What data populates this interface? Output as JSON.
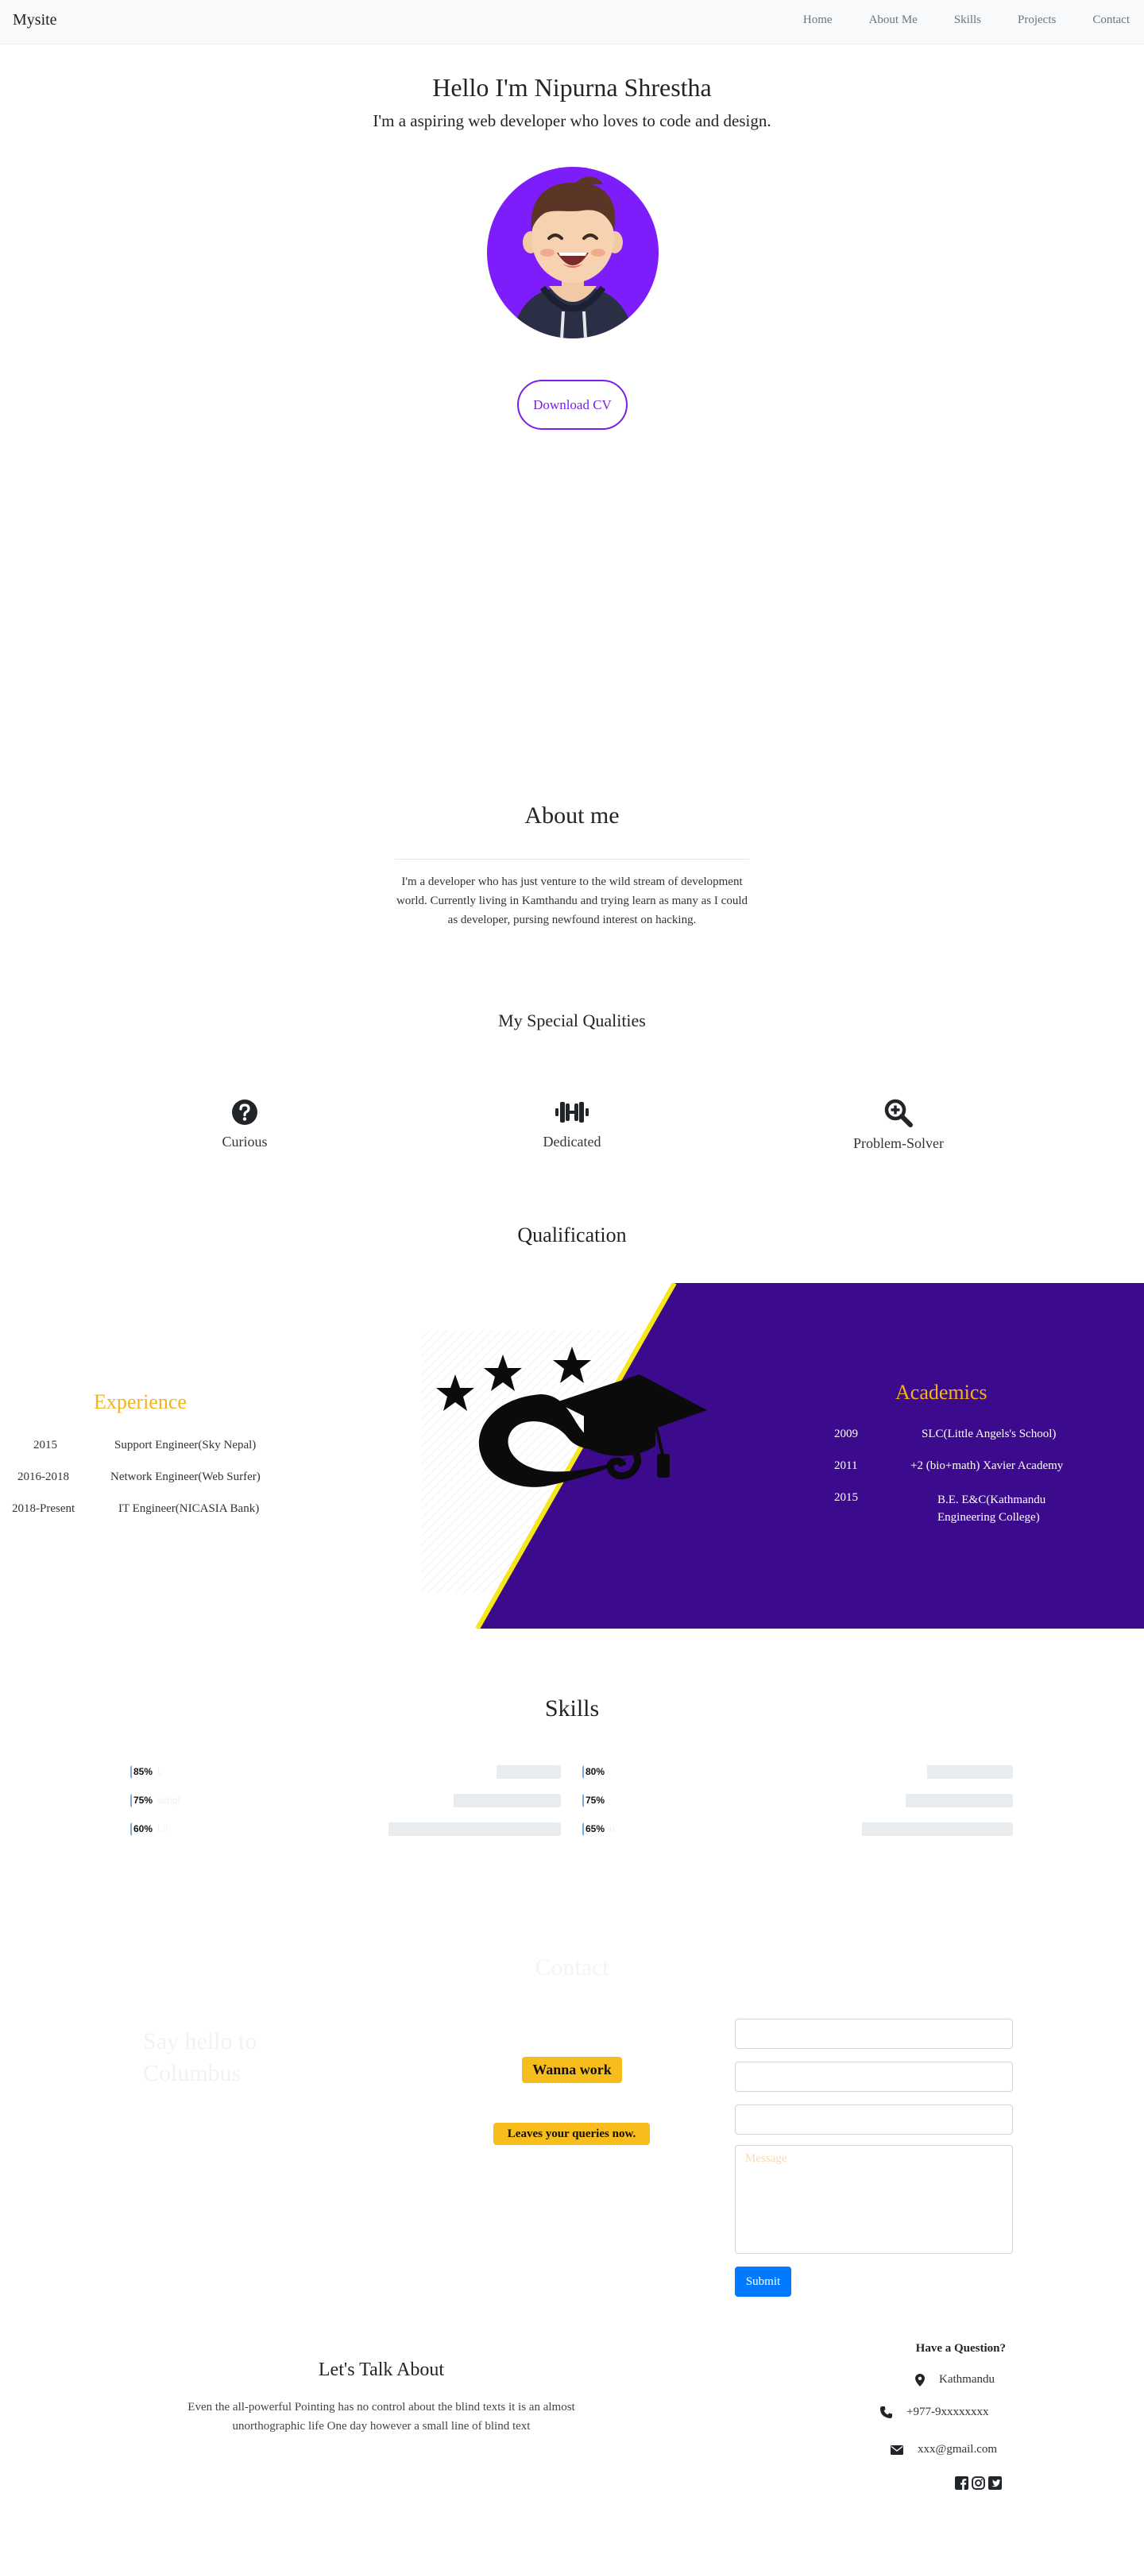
{
  "nav": {
    "brand": "Mysite",
    "links": [
      "Home",
      "About Me",
      "Skills",
      "Projects",
      "Contact"
    ]
  },
  "hero": {
    "title": "Hello I'm Nipurna Shrestha",
    "subtitle": "I'm a aspiring web developer who loves to code and design.",
    "cv_button": "Download CV"
  },
  "about": {
    "title": "About me",
    "text": "I'm a developer who has just venture to the wild stream of development world. Currently living in Kamthandu and trying learn as many as I could as developer, pursing newfound interest on hacking."
  },
  "qualities": {
    "title": "My Special Qualities",
    "items": [
      {
        "label": "Curious",
        "icon": "question-circle-icon"
      },
      {
        "label": "Dedicated",
        "icon": "dumbbell-icon"
      },
      {
        "label": "Problem-Solver",
        "icon": "search-plus-icon"
      }
    ]
  },
  "qualification": {
    "title": "Qualification",
    "experience_title": "Experience",
    "experience": [
      {
        "year": "2015",
        "role": "Support Engineer(Sky Nepal)"
      },
      {
        "year": "2016-2018",
        "role": "Network Engineer(Web Surfer)"
      },
      {
        "year": "2018-Present",
        "role": "IT Engineer(NICASIA Bank)"
      }
    ],
    "academics_title": "Academics",
    "academics": [
      {
        "year": "2009",
        "school": "SLC(Little Angels's School)"
      },
      {
        "year": "2011",
        "school": "+2 (bio+math) Xavier Academy"
      },
      {
        "year": "2015",
        "school": "B.E. E&C(Kathmandu Engineering College)"
      }
    ],
    "colors": {
      "accent": "#f3b41b",
      "band": "#3d0a8e",
      "divider": "#f5e71a"
    }
  },
  "skills": {
    "title": "Skills",
    "bars": [
      {
        "percent": 85,
        "label": "85%",
        "ghost": "L"
      },
      {
        "percent": 80,
        "label": "80%",
        "ghost": ""
      },
      {
        "percent": 75,
        "label": "75%",
        "ghost": "script"
      },
      {
        "percent": 75,
        "label": "75%",
        "ghost": ""
      },
      {
        "percent": 60,
        "label": "60%",
        "ghost": "L/I"
      },
      {
        "percent": 65,
        "label": "65%",
        "ghost": "n"
      }
    ]
  },
  "contact": {
    "title": "Contact",
    "faint_heading": "Say hello to\nColumbus",
    "badge1": "Wanna work",
    "badge2": "Leaves your queries now.",
    "message_placeholder": "Message",
    "submit": "Submit"
  },
  "footer": {
    "talk_title": "Let's Talk About",
    "talk_text": "Even the all-powerful Pointing has no control about the blind texts it is an almost unorthographic life One day however a small line of blind text",
    "question_title": "Have a Question?",
    "location": "Kathmandu",
    "phone": "+977-9xxxxxxxx",
    "email": "xxx@gmail.com"
  }
}
